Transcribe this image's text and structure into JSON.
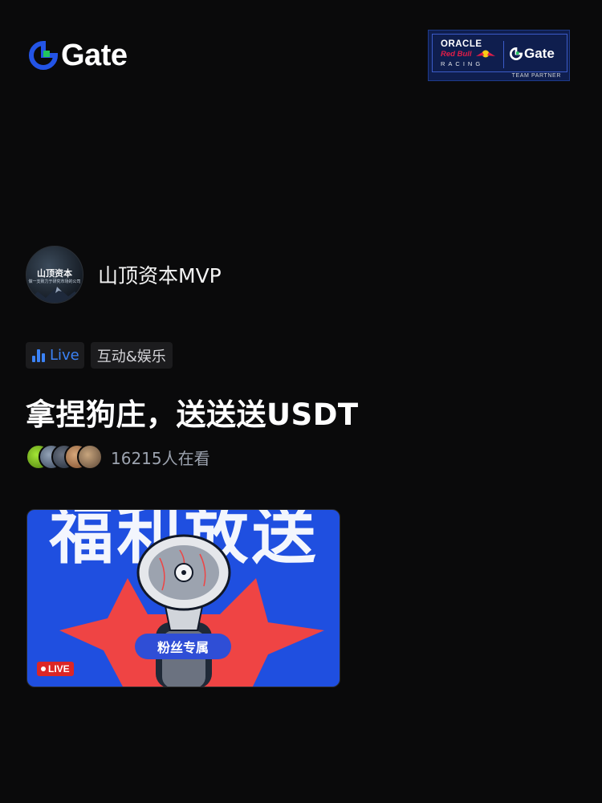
{
  "brand": {
    "name": "Gate",
    "accent": "#2354E6",
    "logo_icon": "gate-logo-icon"
  },
  "partner": {
    "line1": "ORACLE",
    "line2": "Red Bull",
    "line3": "RACING",
    "gate": "Gate",
    "tagline": "TEAM PARTNER"
  },
  "host": {
    "name": "山顶资本MVP",
    "avatar_title": "山顶资本",
    "avatar_subtitle": "做一支致力于研究市场的公司"
  },
  "tags": {
    "live": "Live",
    "category": "互动&娱乐"
  },
  "stream": {
    "title": "拿捏狗庄，送送送USDT",
    "viewers": "16215人在看",
    "thumbnail": {
      "headline": "福利放送",
      "badge": "粉丝专属",
      "live_label": "LIVE"
    }
  },
  "colors": {
    "background": "#0A0A0B",
    "live_blue": "#3B82F6",
    "live_red": "#DC2626",
    "thumb_blue": "#1F4FE0"
  }
}
